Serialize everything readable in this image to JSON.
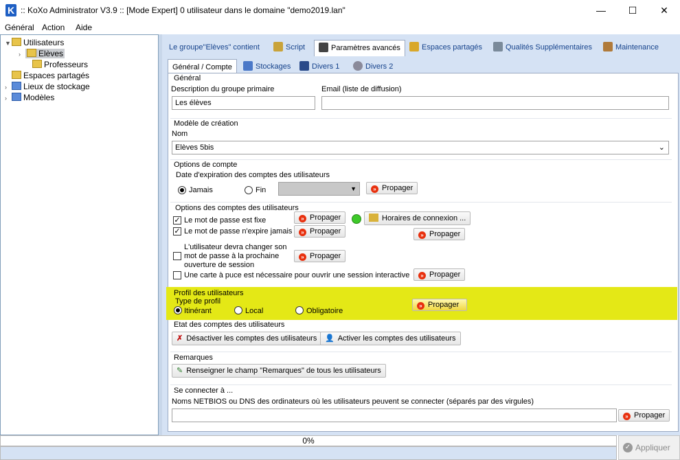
{
  "window": {
    "title": ":: KoXo Administrator V3.9 :: [Mode Expert] 0 utilisateur dans le domaine \"demo2019.lan\"",
    "app_icon": "K",
    "minimize": "—",
    "maximize": "☐",
    "close": "✕"
  },
  "menu": [
    "Général",
    "Action",
    "Aide"
  ],
  "tree": {
    "root": "Utilisateurs",
    "eleves": "Elèves",
    "professeurs": "Professeurs",
    "espaces": "Espaces partagés",
    "lieux": "Lieux de stockage",
    "modeles": "Modèles"
  },
  "tabs_top": [
    "Le groupe\"Elèves\" contient",
    "Script",
    "Paramètres avancés",
    "Espaces partagés",
    "Qualités Supplémentaires",
    "Maintenance"
  ],
  "tabs_sub": [
    "Général / Compte",
    "Stockages",
    "Divers 1",
    "Divers 2"
  ],
  "general": {
    "title": "Général",
    "desc_label": "Description du groupe primaire",
    "desc_value": "Les élèves",
    "email_label": "Email (liste de diffusion)",
    "email_value": ""
  },
  "modele": {
    "title": "Modèle de création",
    "nom_label": "Nom",
    "nom_value": "Elèves 5bis"
  },
  "options": {
    "title": "Options de compte",
    "expiration_label": "Date d'expiration des comptes des utilisateurs",
    "jamais": "Jamais",
    "fin": "Fin",
    "propager": "Propager"
  },
  "options_users": {
    "title": "Options des comptes des utilisateurs",
    "pwd_fixe": "Le mot de passe est fixe",
    "pwd_expire": "Le mot de passe n'expire jamais",
    "changer_l1": "L'utilisateur devra changer son",
    "changer_l2": "mot de passe à la prochaine",
    "changer_l3": "ouverture de session",
    "carte": "Une carte à puce est nécessaire pour ouvrir une session interactive",
    "horaires": "Horaires de connexion ..."
  },
  "profil": {
    "title": "Profil des utilisateurs",
    "type": "Type de profil",
    "itinerant": "Itinérant",
    "local": "Local",
    "obligatoire": "Obligatoire"
  },
  "etat": {
    "title": "Etat des comptes des utilisateurs",
    "desactiver": "Désactiver les comptes des utilisateurs",
    "activer": "Activer les comptes des utilisateurs"
  },
  "remarques": {
    "title": "Remarques",
    "btn": "Renseigner le champ \"Remarques\" de tous les utilisateurs"
  },
  "connect": {
    "title": "Se connecter à ...",
    "label": "Noms NETBIOS ou DNS des ordinateurs où les utilisateurs peuvent se connecter (séparés par des virgules)",
    "value": ""
  },
  "progress": {
    "value": 0,
    "text": "0%"
  },
  "apply": "Appliquer",
  "colors": {
    "highlight": "#e4e816",
    "tab_text": "#15428b",
    "panel_bg": "#d5e2f4"
  }
}
